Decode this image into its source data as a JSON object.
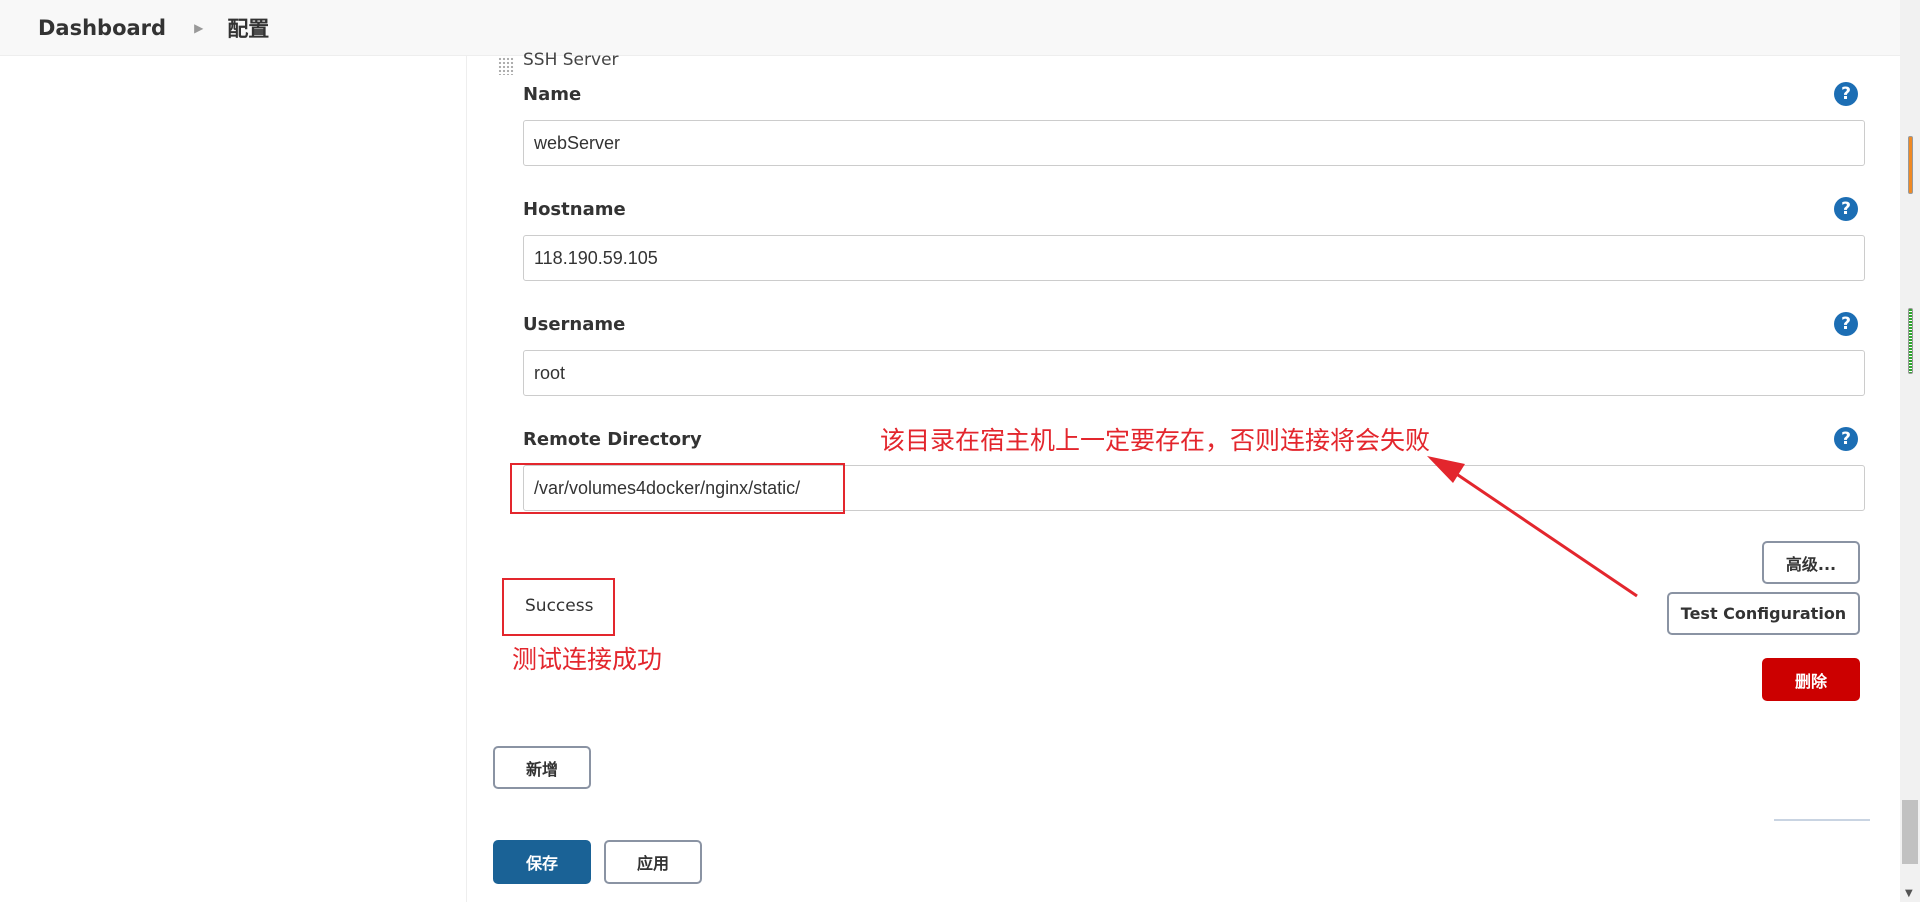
{
  "breadcrumb": {
    "root": "Dashboard",
    "current": "配置"
  },
  "section": {
    "title": "SSH Server"
  },
  "fields": {
    "name": {
      "label": "Name",
      "value": "webServer"
    },
    "hostname": {
      "label": "Hostname",
      "value": "118.190.59.105"
    },
    "username": {
      "label": "Username",
      "value": "root"
    },
    "remote_directory": {
      "label": "Remote Directory",
      "value": "/var/volumes4docker/nginx/static/"
    }
  },
  "help_icon": {
    "glyph": "?"
  },
  "annotations": {
    "directory_note": "该目录在宿主机上一定要存在，否则连接将会失败",
    "success_note": "测试连接成功"
  },
  "status": {
    "text": "Success"
  },
  "buttons": {
    "advanced": "高级...",
    "test_configuration": "Test Configuration",
    "delete": "删除",
    "add": "新增",
    "save": "保存",
    "apply": "应用"
  },
  "colors": {
    "annotation_red": "#e3262d",
    "help_blue": "#1c6eb4",
    "delete_red": "#cc0000",
    "save_blue": "#1a6296"
  }
}
